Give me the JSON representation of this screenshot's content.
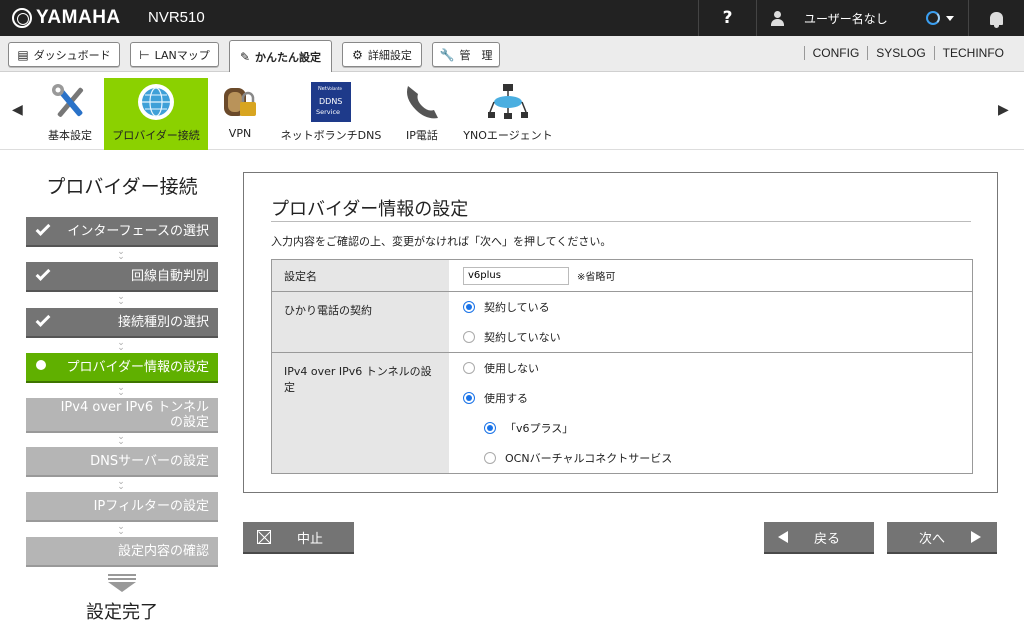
{
  "topbar": {
    "brand": "YAMAHA",
    "model": "NVR510",
    "help": "?",
    "user_name": "ユーザー名なし"
  },
  "tabs": [
    {
      "label": "ダッシュボード",
      "icon": "dashboard-icon"
    },
    {
      "label": "LANマップ",
      "icon": "lan-map-icon"
    },
    {
      "label": "かんたん設定",
      "icon": "wand-icon",
      "active": true
    },
    {
      "label": "詳細設定",
      "icon": "gear-icon"
    },
    {
      "label": "管　理",
      "icon": "wrench-icon"
    }
  ],
  "top_links": [
    "CONFIG",
    "SYSLOG",
    "TECHINFO"
  ],
  "features": [
    {
      "label": "基本設定",
      "icon": "tools-icon"
    },
    {
      "label": "プロバイダー接続",
      "icon": "globe-icon",
      "active": true
    },
    {
      "label": "VPN",
      "icon": "vpn-icon"
    },
    {
      "label": "ネットボランチDNS",
      "icon": "ddns-icon",
      "icon_text": [
        "Net",
        "Volante",
        "DDNS",
        "Service"
      ]
    },
    {
      "label": "IP電話",
      "icon": "phone-icon"
    },
    {
      "label": "YNOエージェント",
      "icon": "network-icon"
    }
  ],
  "sidebar": {
    "title": "プロバイダー接続",
    "steps": [
      {
        "label": "インターフェースの選択",
        "state": "done"
      },
      {
        "label": "回線自動判別",
        "state": "done"
      },
      {
        "label": "接続種別の選択",
        "state": "done"
      },
      {
        "label": "プロバイダー情報の設定",
        "state": "current"
      },
      {
        "label": "IPv4 over IPv6 トンネル",
        "label2": "の設定",
        "state": "pending"
      },
      {
        "label": "DNSサーバーの設定",
        "state": "pending"
      },
      {
        "label": "IPフィルターの設定",
        "state": "pending"
      },
      {
        "label": "設定内容の確認",
        "state": "pending"
      }
    ],
    "finish": "設定完了"
  },
  "panel": {
    "title": "プロバイダー情報の設定",
    "description": "入力内容をご確認の上、変更がなければ「次へ」を押してください。",
    "setting_name": {
      "label": "設定名",
      "value": "v6plus",
      "note": "※省略可"
    },
    "hikari": {
      "label": "ひかり電話の契約",
      "options": [
        {
          "label": "契約している",
          "checked": true
        },
        {
          "label": "契約していない",
          "checked": false
        }
      ]
    },
    "tunnel": {
      "label": "IPv4 over IPv6 トンネルの設定",
      "options": [
        {
          "label": "使用しない",
          "checked": false
        },
        {
          "label": "使用する",
          "checked": true
        }
      ],
      "sub_options": [
        {
          "label": "「v6プラス」",
          "checked": true
        },
        {
          "label": "OCNバーチャルコネクトサービス",
          "checked": false
        }
      ]
    }
  },
  "buttons": {
    "cancel": "中止",
    "back": "戻る",
    "next": "次へ"
  },
  "colors": {
    "accent_green": "#8bd100",
    "step_current": "#60b000",
    "radio_blue": "#1a73e8",
    "topbar": "#222222"
  }
}
